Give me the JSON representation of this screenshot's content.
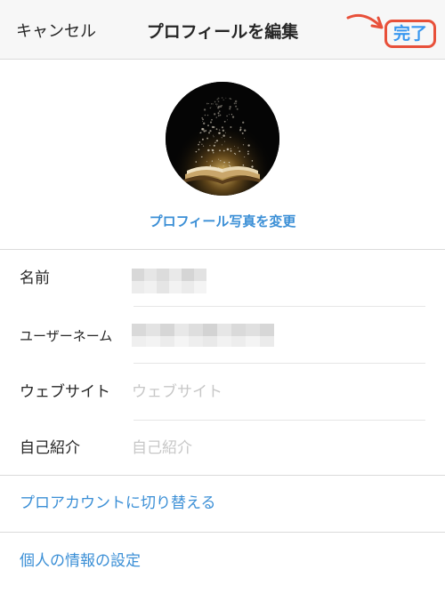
{
  "nav": {
    "cancel_label": "キャンセル",
    "title": "プロフィールを編集",
    "done_label": "完了"
  },
  "avatar": {
    "icon": "book-glitter-photo",
    "change_photo_label": "プロフィール写真を変更"
  },
  "fields": [
    {
      "label": "名前",
      "value": "",
      "placeholder": "",
      "redacted": true
    },
    {
      "label": "ユーザーネーム",
      "value": "",
      "placeholder": "",
      "redacted": true
    },
    {
      "label": "ウェブサイト",
      "value": "",
      "placeholder": "ウェブサイト",
      "redacted": false
    },
    {
      "label": "自己紹介",
      "value": "",
      "placeholder": "自己紹介",
      "redacted": false
    }
  ],
  "links": {
    "switch_to_pro": "プロアカウントに切り替える",
    "personal_info": "個人の情報の設定"
  },
  "colors": {
    "accent_link": "#3b8fd6",
    "annotation": "#e8503a",
    "divider": "#dbdbdb",
    "placeholder": "#c7c7c7"
  }
}
